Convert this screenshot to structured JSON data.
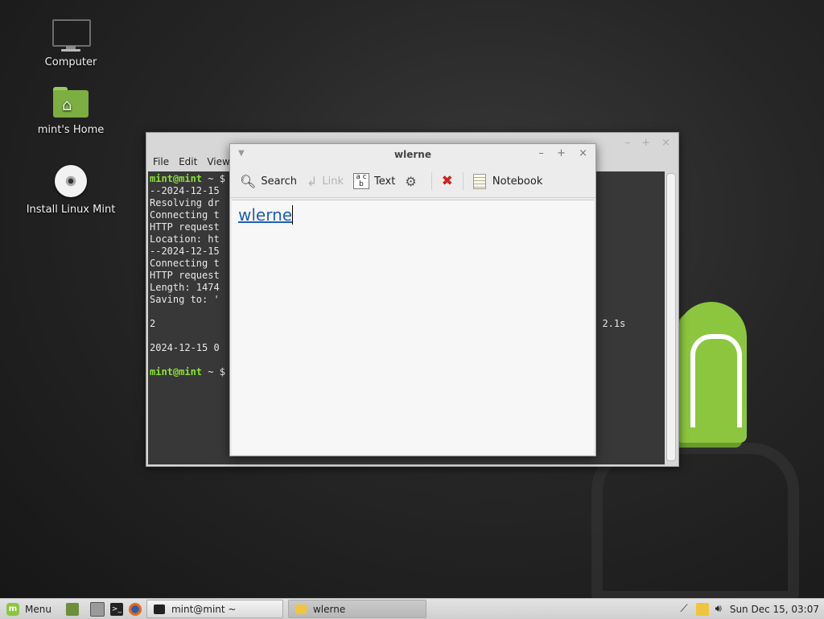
{
  "desktop": {
    "icons": [
      {
        "label": "Computer",
        "icon": "computer-icon"
      },
      {
        "label": "mint's Home",
        "icon": "home-folder-icon"
      },
      {
        "label": "Install Linux Mint",
        "icon": "disc-icon"
      }
    ]
  },
  "terminal": {
    "menu": [
      "File",
      "Edit",
      "View"
    ],
    "prompt": "mint@mint",
    "lines": [
      "--2024-12-15",
      "Resolving dr",
      "Connecting t",
      "HTTP request",
      "Location: ht",
      "--2024-12-15",
      "Connecting t",
      "HTTP request",
      "Length: 1474",
      "Saving to: '",
      "",
      "2",
      "",
      "2024-12-15 0"
    ],
    "prompt_tail": " ~ $",
    "right_fragment": "n 2.1s"
  },
  "note": {
    "title": "wlerne",
    "toolbar": {
      "search": "Search",
      "link": "Link",
      "text": "Text",
      "notebook": "Notebook"
    },
    "content": "wlerne"
  },
  "taskbar": {
    "menu_label": "Menu",
    "tasks": [
      {
        "label": "mint@mint ~",
        "icon": "terminal-icon"
      },
      {
        "label": "wlerne",
        "icon": "note-icon"
      }
    ],
    "clock": "Sun Dec 15, 03:07"
  },
  "colors": {
    "mint_green": "#8cc63f",
    "terminal_bg": "#383838",
    "prompt_green": "#8ae234",
    "link_blue": "#1f5fb4"
  }
}
